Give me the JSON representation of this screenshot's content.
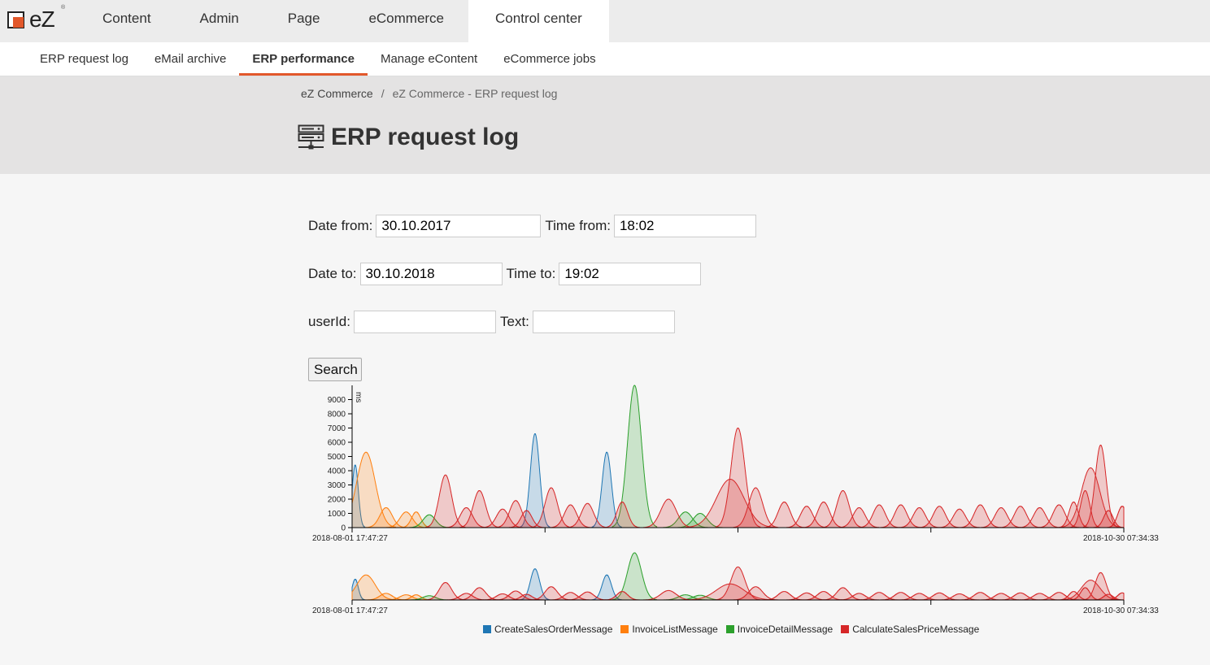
{
  "app": {
    "logo_text": "eZ",
    "logo_reg": "®"
  },
  "topnav": [
    {
      "label": "Content"
    },
    {
      "label": "Admin"
    },
    {
      "label": "Page"
    },
    {
      "label": "eCommerce"
    },
    {
      "label": "Control center",
      "active": true
    }
  ],
  "subnav": [
    {
      "label": "ERP request log"
    },
    {
      "label": "eMail archive"
    },
    {
      "label": "ERP performance",
      "active": true
    },
    {
      "label": "Manage eContent"
    },
    {
      "label": "eCommerce jobs"
    }
  ],
  "breadcrumb": {
    "root": "eZ Commerce",
    "separator": "/",
    "current": "eZ Commerce - ERP request log"
  },
  "page": {
    "title": "ERP request log",
    "icon": "server-icon"
  },
  "form": {
    "date_from_label": "Date from:",
    "date_from": "30.10.2017",
    "time_from_label": "Time from:",
    "time_from": "18:02",
    "date_to_label": "Date to:",
    "date_to": "30.10.2018",
    "time_to_label": "Time to:",
    "time_to": "19:02",
    "userid_label": "userId:",
    "userid": "",
    "text_label": "Text:",
    "text": "",
    "search_label": "Search"
  },
  "chart_data": {
    "type": "area",
    "ylabel": "ms",
    "yticks": [
      0,
      1000,
      2000,
      3000,
      4000,
      5000,
      6000,
      7000,
      8000,
      9000
    ],
    "ylim": [
      0,
      10000
    ],
    "x_start_label": "2018-08-01 17:47:27",
    "x_end_label": "2018-10-30 07:34:33",
    "series": [
      {
        "name": "CreateSalesOrderMessage",
        "color": "#1f77b4",
        "peaks": [
          {
            "x": 0.004,
            "y": 4400,
            "w": 0.004
          },
          {
            "x": 0.237,
            "y": 6600,
            "w": 0.006
          },
          {
            "x": 0.33,
            "y": 5300,
            "w": 0.006
          }
        ]
      },
      {
        "name": "InvoiceListMessage",
        "color": "#ff7f0e",
        "peaks": [
          {
            "x": 0.018,
            "y": 5300,
            "w": 0.012
          },
          {
            "x": 0.044,
            "y": 1400,
            "w": 0.008
          },
          {
            "x": 0.07,
            "y": 1100,
            "w": 0.008
          },
          {
            "x": 0.083,
            "y": 1100,
            "w": 0.006
          }
        ]
      },
      {
        "name": "InvoiceDetailMessage",
        "color": "#2ca02c",
        "peaks": [
          {
            "x": 0.1,
            "y": 900,
            "w": 0.008
          },
          {
            "x": 0.366,
            "y": 10000,
            "w": 0.009
          },
          {
            "x": 0.432,
            "y": 1100,
            "w": 0.009
          },
          {
            "x": 0.451,
            "y": 1000,
            "w": 0.009
          }
        ]
      },
      {
        "name": "CalculateSalesPriceMessage",
        "color": "#d62728",
        "peaks": [
          {
            "x": 0.121,
            "y": 3700,
            "w": 0.008
          },
          {
            "x": 0.148,
            "y": 1400,
            "w": 0.008
          },
          {
            "x": 0.165,
            "y": 2600,
            "w": 0.008
          },
          {
            "x": 0.195,
            "y": 1300,
            "w": 0.008
          },
          {
            "x": 0.212,
            "y": 1900,
            "w": 0.008
          },
          {
            "x": 0.226,
            "y": 1200,
            "w": 0.007
          },
          {
            "x": 0.258,
            "y": 2800,
            "w": 0.008
          },
          {
            "x": 0.283,
            "y": 1600,
            "w": 0.008
          },
          {
            "x": 0.305,
            "y": 1700,
            "w": 0.008
          },
          {
            "x": 0.35,
            "y": 1800,
            "w": 0.007
          },
          {
            "x": 0.41,
            "y": 2000,
            "w": 0.01
          },
          {
            "x": 0.49,
            "y": 3400,
            "w": 0.018
          },
          {
            "x": 0.5,
            "y": 7000,
            "w": 0.009
          },
          {
            "x": 0.523,
            "y": 2800,
            "w": 0.009
          },
          {
            "x": 0.56,
            "y": 1800,
            "w": 0.008
          },
          {
            "x": 0.589,
            "y": 1500,
            "w": 0.008
          },
          {
            "x": 0.611,
            "y": 1800,
            "w": 0.008
          },
          {
            "x": 0.636,
            "y": 2600,
            "w": 0.008
          },
          {
            "x": 0.657,
            "y": 1400,
            "w": 0.008
          },
          {
            "x": 0.683,
            "y": 1600,
            "w": 0.008
          },
          {
            "x": 0.711,
            "y": 1600,
            "w": 0.008
          },
          {
            "x": 0.735,
            "y": 1400,
            "w": 0.008
          },
          {
            "x": 0.761,
            "y": 1500,
            "w": 0.008
          },
          {
            "x": 0.787,
            "y": 1300,
            "w": 0.008
          },
          {
            "x": 0.814,
            "y": 1600,
            "w": 0.008
          },
          {
            "x": 0.841,
            "y": 1400,
            "w": 0.008
          },
          {
            "x": 0.866,
            "y": 1500,
            "w": 0.008
          },
          {
            "x": 0.891,
            "y": 1400,
            "w": 0.008
          },
          {
            "x": 0.916,
            "y": 1600,
            "w": 0.008
          },
          {
            "x": 0.935,
            "y": 1800,
            "w": 0.006
          },
          {
            "x": 0.957,
            "y": 4200,
            "w": 0.012
          },
          {
            "x": 0.95,
            "y": 2600,
            "w": 0.006
          },
          {
            "x": 0.97,
            "y": 5800,
            "w": 0.007
          },
          {
            "x": 0.98,
            "y": 1200,
            "w": 0.006
          },
          {
            "x": 0.998,
            "y": 1500,
            "w": 0.006
          }
        ]
      }
    ]
  }
}
